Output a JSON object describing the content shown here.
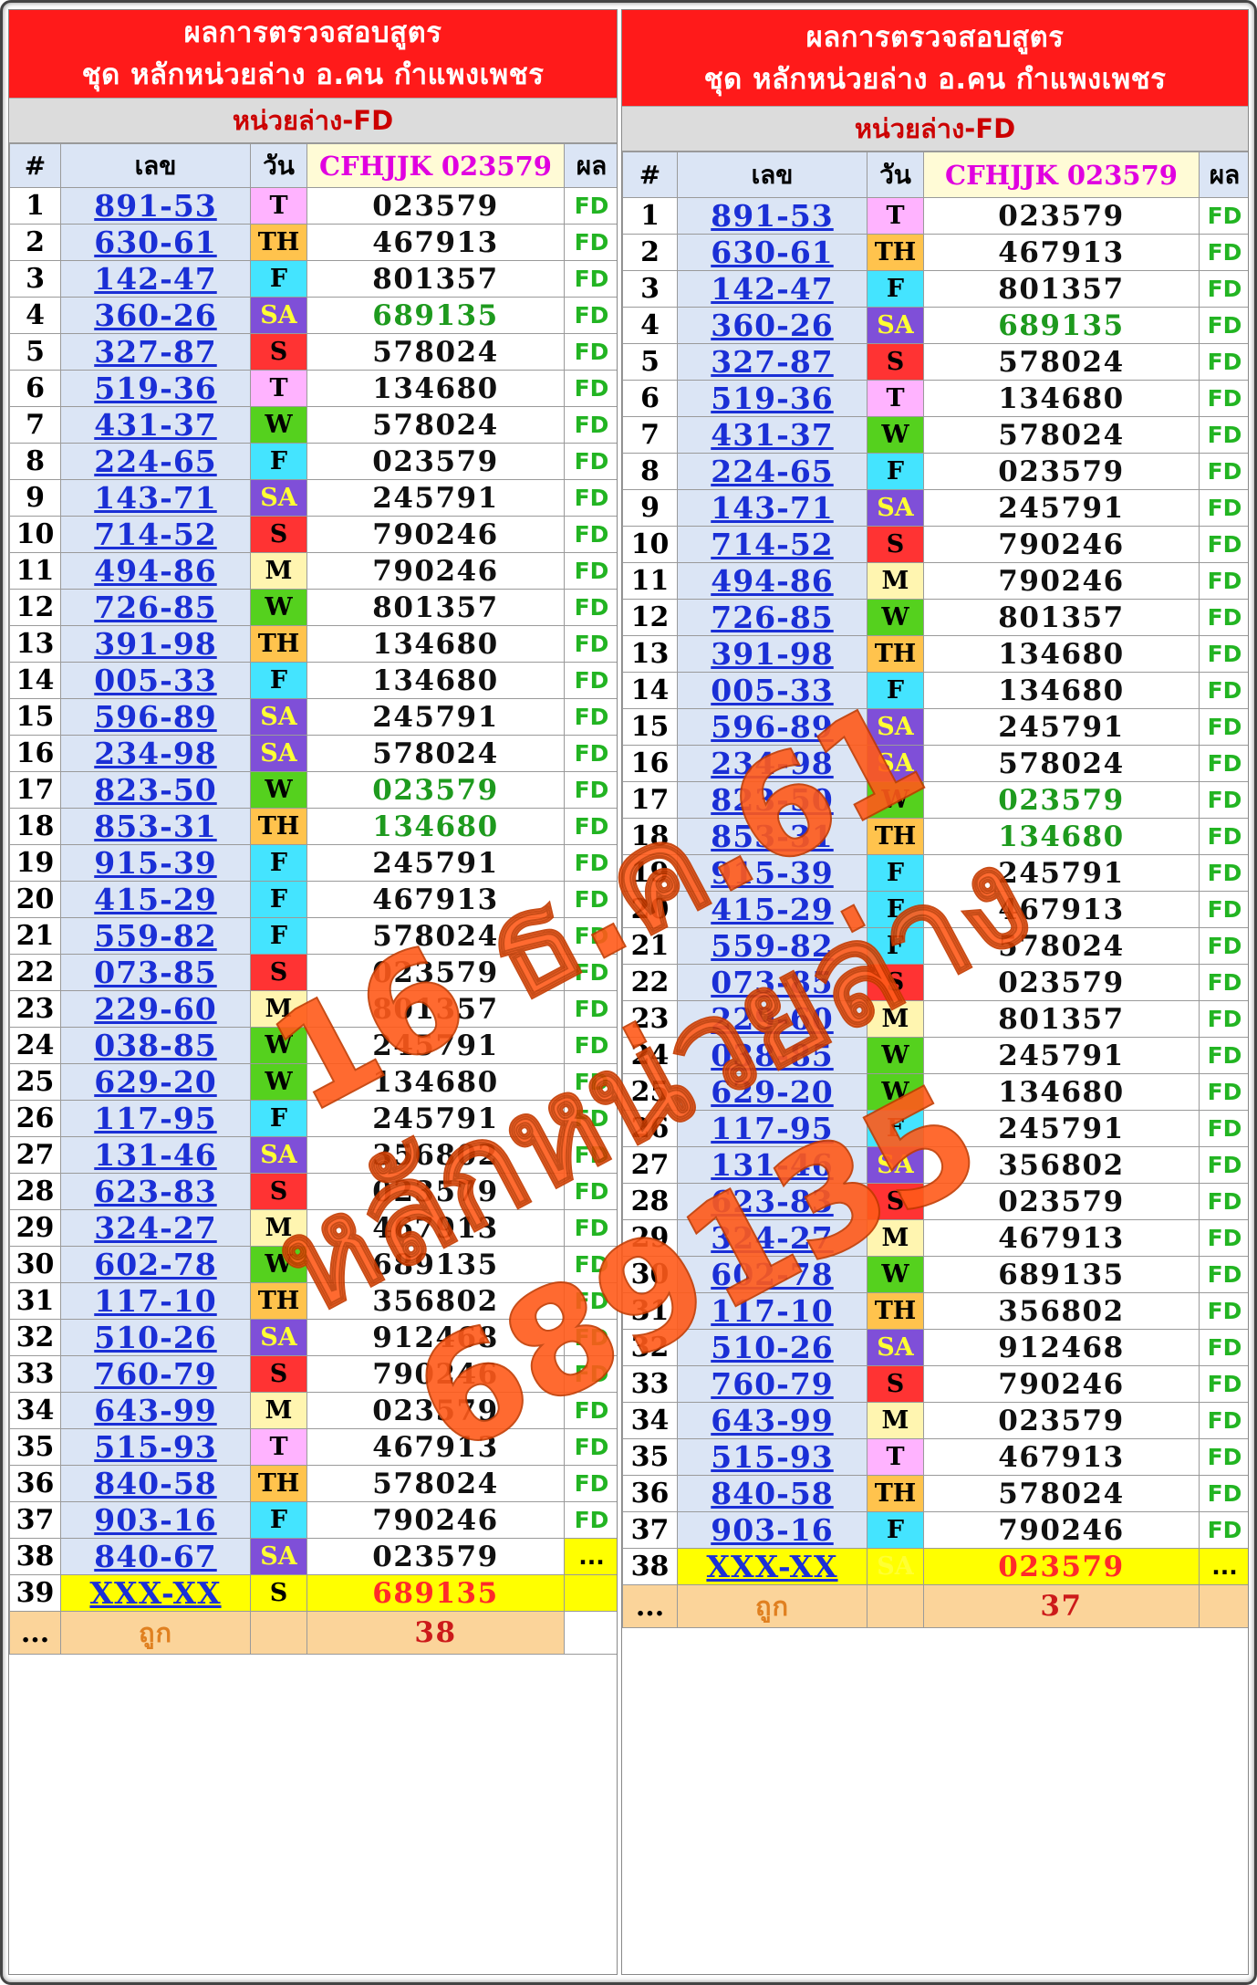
{
  "header": {
    "title_line1": "ผลการตรวจสอบสูตร",
    "title_line2": "ชุด หลักหน่วยล่าง อ.คน กำแพงเพชร",
    "subtitle": "หน่วยล่าง-FD"
  },
  "columns": {
    "index": "#",
    "number": "เลข",
    "day": "วัน",
    "code": "CFHJJK 023579",
    "result": "ผล"
  },
  "result_label": "FD",
  "colors": {
    "title_bg": "#ff1a1a",
    "subtitle_text": "#cc0000",
    "link_blue": "#1a2fd6",
    "result_green": "#22b422",
    "watermark": "#ff5a1a"
  },
  "day_legend": {
    "T": "#ffb3ff",
    "TH": "#ffc34d",
    "F": "#44e4ff",
    "SA": "#7f4fd8",
    "S": "#ff3333",
    "W": "#55d11e",
    "M": "#fff5b0"
  },
  "rows": [
    {
      "n": "1",
      "num": "891-53",
      "day": "T",
      "code": "023579"
    },
    {
      "n": "2",
      "num": "630-61",
      "day": "TH",
      "code": "467913"
    },
    {
      "n": "3",
      "num": "142-47",
      "day": "F",
      "code": "801357"
    },
    {
      "n": "4",
      "num": "360-26",
      "day": "SA",
      "code": "689135",
      "green": true
    },
    {
      "n": "5",
      "num": "327-87",
      "day": "S",
      "code": "578024"
    },
    {
      "n": "6",
      "num": "519-36",
      "day": "T",
      "code": "134680"
    },
    {
      "n": "7",
      "num": "431-37",
      "day": "W",
      "code": "578024"
    },
    {
      "n": "8",
      "num": "224-65",
      "day": "F",
      "code": "023579"
    },
    {
      "n": "9",
      "num": "143-71",
      "day": "SA",
      "code": "245791"
    },
    {
      "n": "10",
      "num": "714-52",
      "day": "S",
      "code": "790246"
    },
    {
      "n": "11",
      "num": "494-86",
      "day": "M",
      "code": "790246"
    },
    {
      "n": "12",
      "num": "726-85",
      "day": "W",
      "code": "801357"
    },
    {
      "n": "13",
      "num": "391-98",
      "day": "TH",
      "code": "134680"
    },
    {
      "n": "14",
      "num": "005-33",
      "day": "F",
      "code": "134680"
    },
    {
      "n": "15",
      "num": "596-89",
      "day": "SA",
      "code": "245791"
    },
    {
      "n": "16",
      "num": "234-98",
      "day": "SA",
      "code": "578024"
    },
    {
      "n": "17",
      "num": "823-50",
      "day": "W",
      "code": "023579",
      "green": true
    },
    {
      "n": "18",
      "num": "853-31",
      "day": "TH",
      "code": "134680",
      "green": true
    },
    {
      "n": "19",
      "num": "915-39",
      "day": "F",
      "code": "245791"
    },
    {
      "n": "20",
      "num": "415-29",
      "day": "F",
      "code": "467913"
    },
    {
      "n": "21",
      "num": "559-82",
      "day": "F",
      "code": "578024"
    },
    {
      "n": "22",
      "num": "073-85",
      "day": "S",
      "code": "023579"
    },
    {
      "n": "23",
      "num": "229-60",
      "day": "M",
      "code": "801357"
    },
    {
      "n": "24",
      "num": "038-85",
      "day": "W",
      "code": "245791"
    },
    {
      "n": "25",
      "num": "629-20",
      "day": "W",
      "code": "134680"
    },
    {
      "n": "26",
      "num": "117-95",
      "day": "F",
      "code": "245791"
    },
    {
      "n": "27",
      "num": "131-46",
      "day": "SA",
      "code": "356802"
    },
    {
      "n": "28",
      "num": "623-83",
      "day": "S",
      "code": "023579"
    },
    {
      "n": "29",
      "num": "324-27",
      "day": "M",
      "code": "467913"
    },
    {
      "n": "30",
      "num": "602-78",
      "day": "W",
      "code": "689135"
    },
    {
      "n": "31",
      "num": "117-10",
      "day": "TH",
      "code": "356802"
    },
    {
      "n": "32",
      "num": "510-26",
      "day": "SA",
      "code": "912468"
    },
    {
      "n": "33",
      "num": "760-79",
      "day": "S",
      "code": "790246"
    },
    {
      "n": "34",
      "num": "643-99",
      "day": "M",
      "code": "023579"
    },
    {
      "n": "35",
      "num": "515-93",
      "day": "T",
      "code": "467913"
    },
    {
      "n": "36",
      "num": "840-58",
      "day": "TH",
      "code": "578024"
    },
    {
      "n": "37",
      "num": "903-16",
      "day": "F",
      "code": "790246"
    },
    {
      "n": "38",
      "num": "840-67",
      "day": "SA",
      "code": "023579",
      "pending": true
    }
  ],
  "left_panel": {
    "last_index": "39",
    "last_number": "XXX-XX",
    "last_day": "S",
    "last_code": "689135",
    "pending_mark": "...",
    "summary_index": "...",
    "summary_label": "ถูก",
    "summary_count": "38"
  },
  "right_panel": {
    "row_count": 37,
    "last_index": "38",
    "last_number": "XXX-XX",
    "last_day": "SA",
    "last_code": "023579",
    "last_result": "...",
    "summary_index": "...",
    "summary_label": "ถูก",
    "summary_count": "37"
  },
  "watermark": {
    "line1": "16 ธ.ค.61",
    "line2": "หลักหน่วยล่าง",
    "line3": "689135"
  }
}
